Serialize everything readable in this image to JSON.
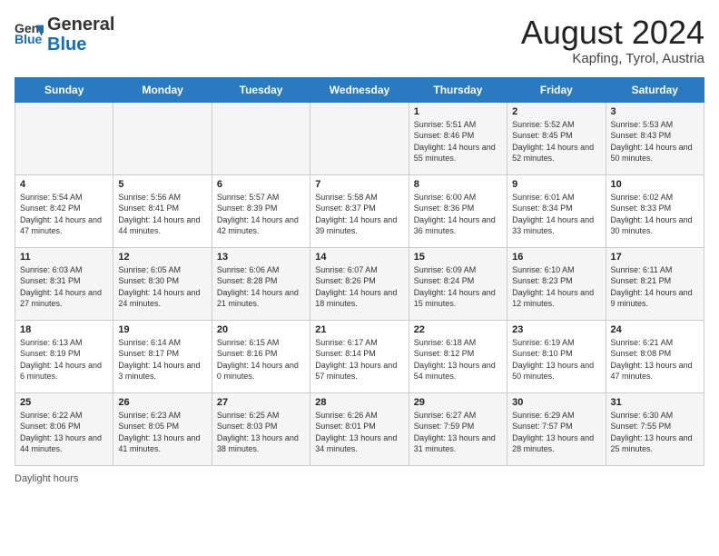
{
  "header": {
    "logo_general": "General",
    "logo_blue": "Blue",
    "month_year": "August 2024",
    "location": "Kapfing, Tyrol, Austria"
  },
  "days_of_week": [
    "Sunday",
    "Monday",
    "Tuesday",
    "Wednesday",
    "Thursday",
    "Friday",
    "Saturday"
  ],
  "weeks": [
    [
      {
        "day": "",
        "info": ""
      },
      {
        "day": "",
        "info": ""
      },
      {
        "day": "",
        "info": ""
      },
      {
        "day": "",
        "info": ""
      },
      {
        "day": "1",
        "info": "Sunrise: 5:51 AM\nSunset: 8:46 PM\nDaylight: 14 hours and 55 minutes."
      },
      {
        "day": "2",
        "info": "Sunrise: 5:52 AM\nSunset: 8:45 PM\nDaylight: 14 hours and 52 minutes."
      },
      {
        "day": "3",
        "info": "Sunrise: 5:53 AM\nSunset: 8:43 PM\nDaylight: 14 hours and 50 minutes."
      }
    ],
    [
      {
        "day": "4",
        "info": "Sunrise: 5:54 AM\nSunset: 8:42 PM\nDaylight: 14 hours and 47 minutes."
      },
      {
        "day": "5",
        "info": "Sunrise: 5:56 AM\nSunset: 8:41 PM\nDaylight: 14 hours and 44 minutes."
      },
      {
        "day": "6",
        "info": "Sunrise: 5:57 AM\nSunset: 8:39 PM\nDaylight: 14 hours and 42 minutes."
      },
      {
        "day": "7",
        "info": "Sunrise: 5:58 AM\nSunset: 8:37 PM\nDaylight: 14 hours and 39 minutes."
      },
      {
        "day": "8",
        "info": "Sunrise: 6:00 AM\nSunset: 8:36 PM\nDaylight: 14 hours and 36 minutes."
      },
      {
        "day": "9",
        "info": "Sunrise: 6:01 AM\nSunset: 8:34 PM\nDaylight: 14 hours and 33 minutes."
      },
      {
        "day": "10",
        "info": "Sunrise: 6:02 AM\nSunset: 8:33 PM\nDaylight: 14 hours and 30 minutes."
      }
    ],
    [
      {
        "day": "11",
        "info": "Sunrise: 6:03 AM\nSunset: 8:31 PM\nDaylight: 14 hours and 27 minutes."
      },
      {
        "day": "12",
        "info": "Sunrise: 6:05 AM\nSunset: 8:30 PM\nDaylight: 14 hours and 24 minutes."
      },
      {
        "day": "13",
        "info": "Sunrise: 6:06 AM\nSunset: 8:28 PM\nDaylight: 14 hours and 21 minutes."
      },
      {
        "day": "14",
        "info": "Sunrise: 6:07 AM\nSunset: 8:26 PM\nDaylight: 14 hours and 18 minutes."
      },
      {
        "day": "15",
        "info": "Sunrise: 6:09 AM\nSunset: 8:24 PM\nDaylight: 14 hours and 15 minutes."
      },
      {
        "day": "16",
        "info": "Sunrise: 6:10 AM\nSunset: 8:23 PM\nDaylight: 14 hours and 12 minutes."
      },
      {
        "day": "17",
        "info": "Sunrise: 6:11 AM\nSunset: 8:21 PM\nDaylight: 14 hours and 9 minutes."
      }
    ],
    [
      {
        "day": "18",
        "info": "Sunrise: 6:13 AM\nSunset: 8:19 PM\nDaylight: 14 hours and 6 minutes."
      },
      {
        "day": "19",
        "info": "Sunrise: 6:14 AM\nSunset: 8:17 PM\nDaylight: 14 hours and 3 minutes."
      },
      {
        "day": "20",
        "info": "Sunrise: 6:15 AM\nSunset: 8:16 PM\nDaylight: 14 hours and 0 minutes."
      },
      {
        "day": "21",
        "info": "Sunrise: 6:17 AM\nSunset: 8:14 PM\nDaylight: 13 hours and 57 minutes."
      },
      {
        "day": "22",
        "info": "Sunrise: 6:18 AM\nSunset: 8:12 PM\nDaylight: 13 hours and 54 minutes."
      },
      {
        "day": "23",
        "info": "Sunrise: 6:19 AM\nSunset: 8:10 PM\nDaylight: 13 hours and 50 minutes."
      },
      {
        "day": "24",
        "info": "Sunrise: 6:21 AM\nSunset: 8:08 PM\nDaylight: 13 hours and 47 minutes."
      }
    ],
    [
      {
        "day": "25",
        "info": "Sunrise: 6:22 AM\nSunset: 8:06 PM\nDaylight: 13 hours and 44 minutes."
      },
      {
        "day": "26",
        "info": "Sunrise: 6:23 AM\nSunset: 8:05 PM\nDaylight: 13 hours and 41 minutes."
      },
      {
        "day": "27",
        "info": "Sunrise: 6:25 AM\nSunset: 8:03 PM\nDaylight: 13 hours and 38 minutes."
      },
      {
        "day": "28",
        "info": "Sunrise: 6:26 AM\nSunset: 8:01 PM\nDaylight: 13 hours and 34 minutes."
      },
      {
        "day": "29",
        "info": "Sunrise: 6:27 AM\nSunset: 7:59 PM\nDaylight: 13 hours and 31 minutes."
      },
      {
        "day": "30",
        "info": "Sunrise: 6:29 AM\nSunset: 7:57 PM\nDaylight: 13 hours and 28 minutes."
      },
      {
        "day": "31",
        "info": "Sunrise: 6:30 AM\nSunset: 7:55 PM\nDaylight: 13 hours and 25 minutes."
      }
    ]
  ],
  "footer": {
    "daylight_label": "Daylight hours"
  }
}
